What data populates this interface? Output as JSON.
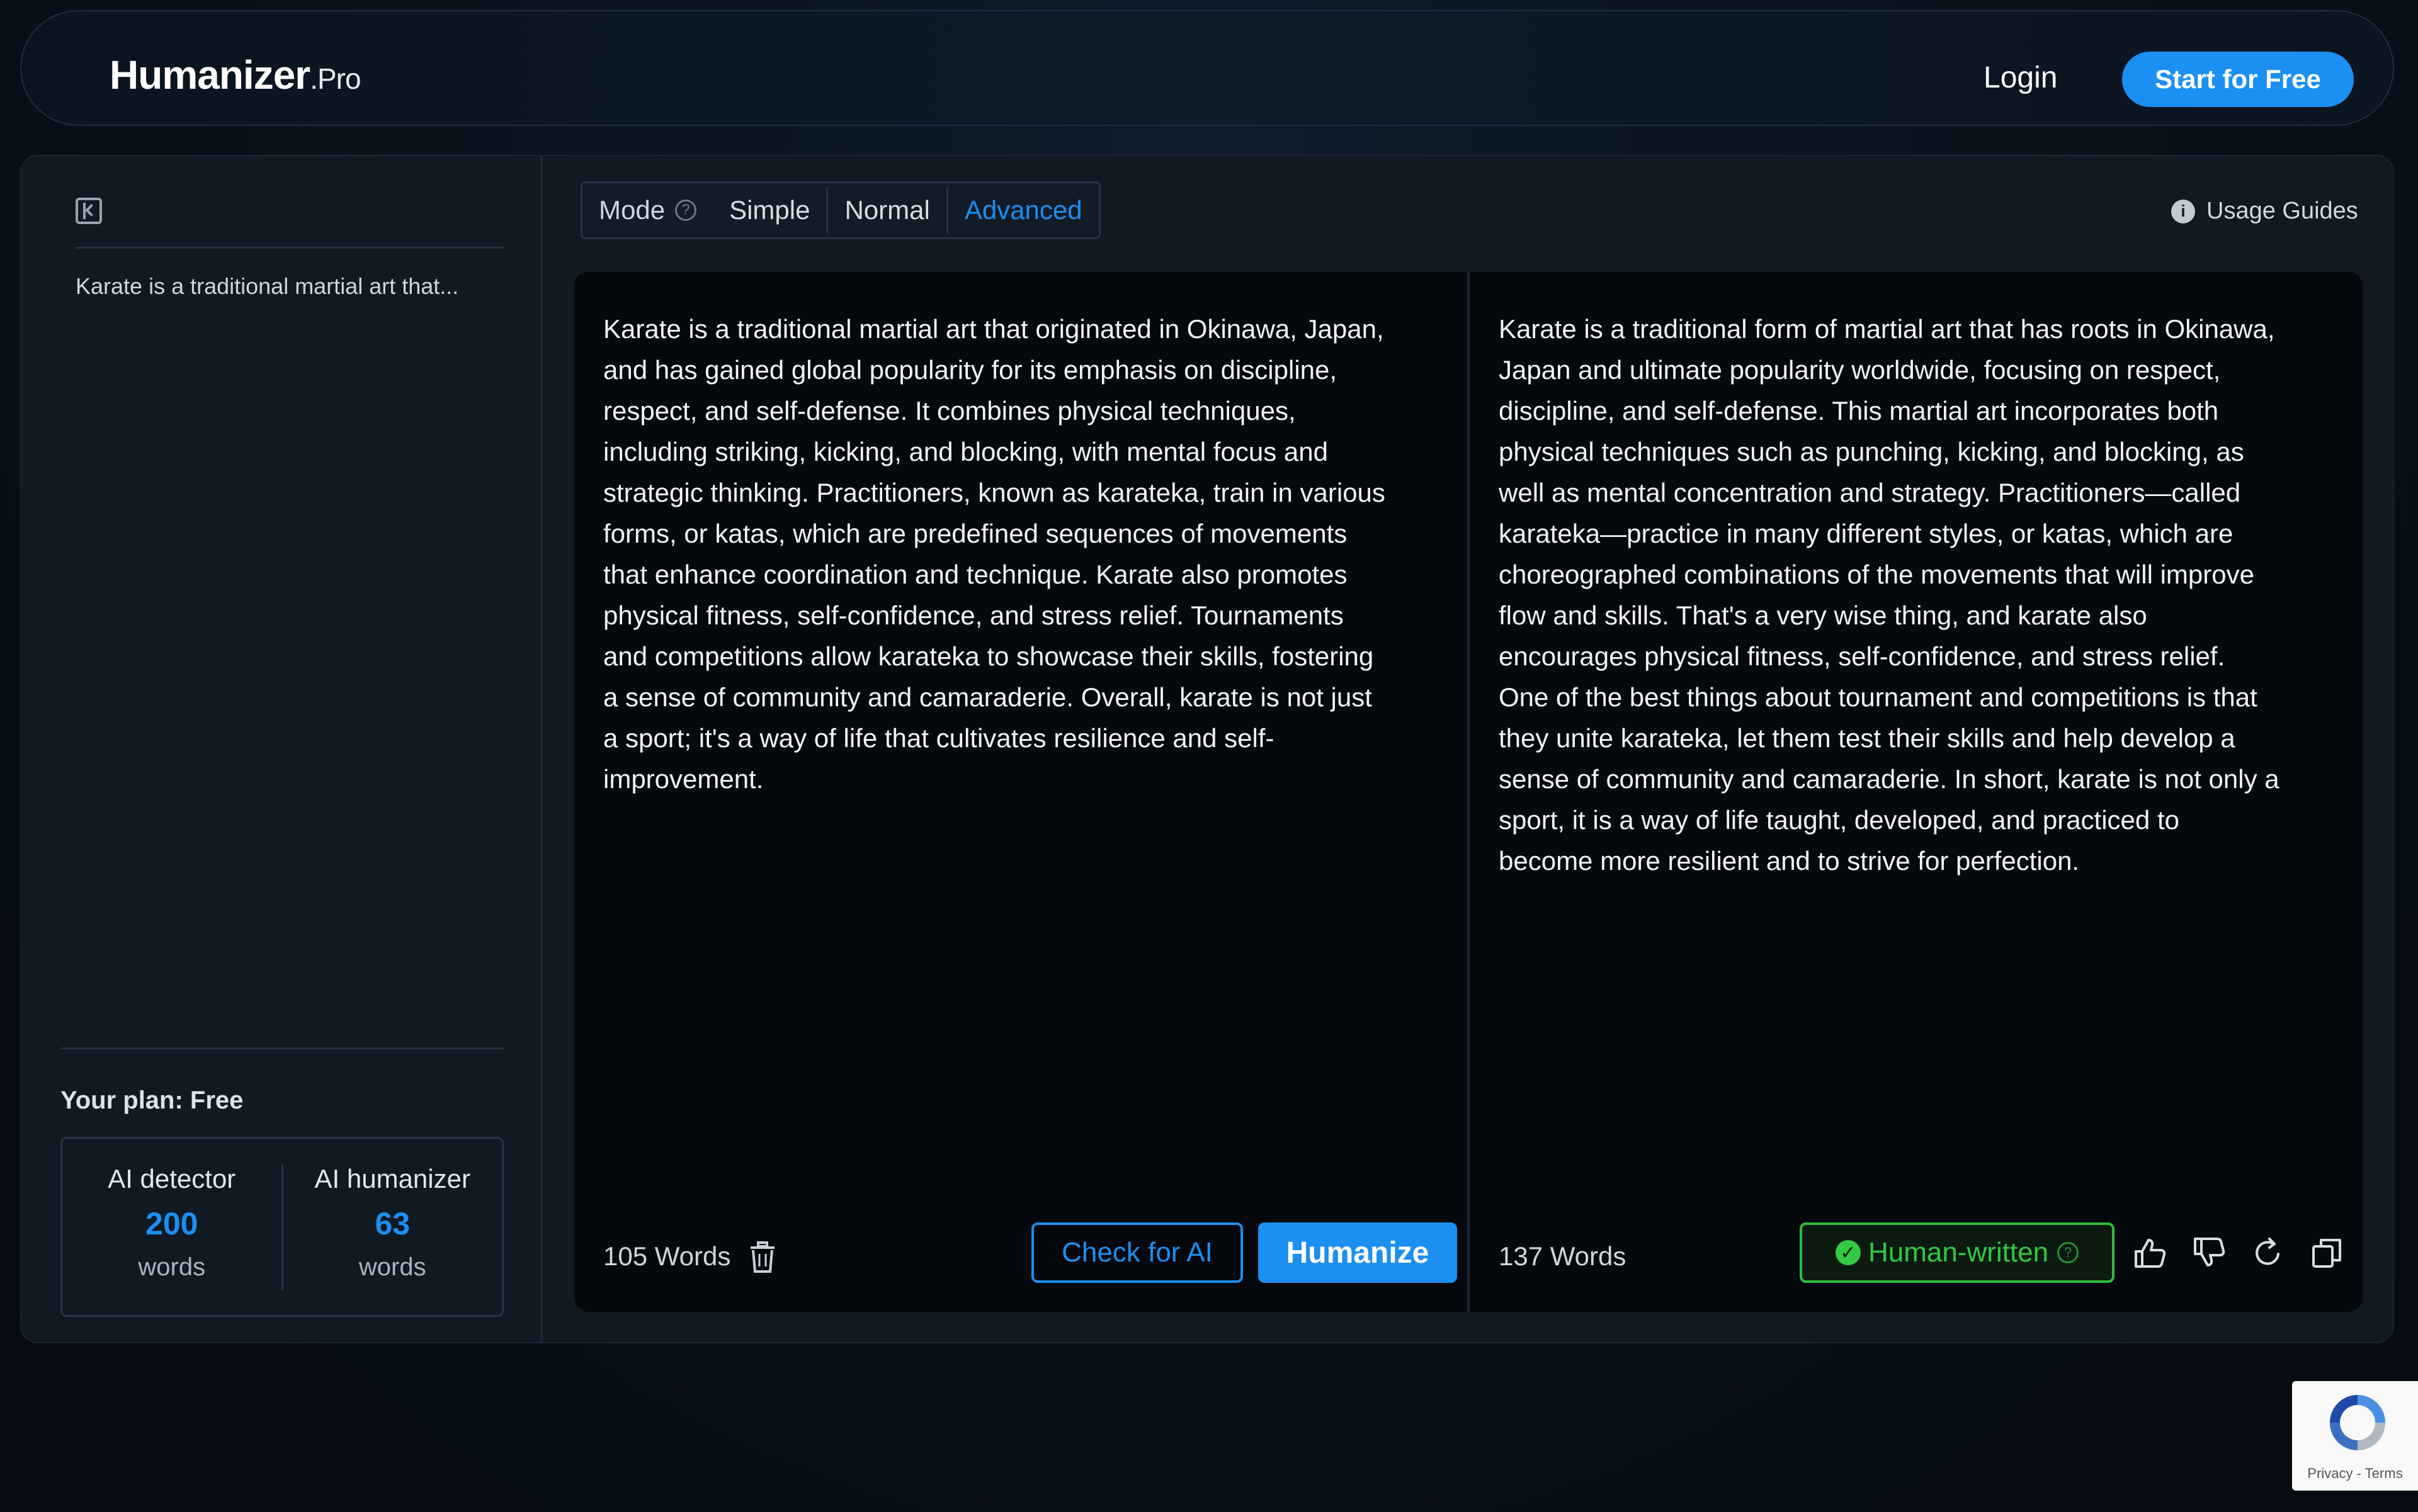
{
  "header": {
    "brand_name": "Humanizer",
    "brand_suffix": ".Pro",
    "login_label": "Login",
    "cta_label": "Start for Free",
    "accent_color": "#1b8ff2"
  },
  "sidebar": {
    "toggle_icon": "sidebar-collapse-icon",
    "history": [
      {
        "label": "Karate is a traditional martial art that..."
      }
    ],
    "plan": {
      "title": "Your plan: Free",
      "detector": {
        "label": "AI detector",
        "value": "200",
        "unit": "words"
      },
      "humanizer": {
        "label": "AI humanizer",
        "value": "63",
        "unit": "words"
      }
    }
  },
  "mode": {
    "label": "Mode",
    "help_icon": "question-icon",
    "options": [
      "Simple",
      "Normal",
      "Advanced"
    ],
    "selected": "Advanced"
  },
  "usage_guides": {
    "icon": "info-icon",
    "label": "Usage Guides"
  },
  "input": {
    "text": "Karate is a traditional martial art that originated in Okinawa, Japan,\nand has gained global popularity for its emphasis on discipline,\nrespect, and self-defense. It combines physical techniques,\nincluding striking, kicking, and blocking, with mental focus and\nstrategic thinking. Practitioners, known as karateka, train in various\nforms, or katas, which are predefined sequences of movements\nthat enhance coordination and technique. Karate also promotes\nphysical fitness, self-confidence, and stress relief. Tournaments\nand competitions allow karateka to showcase their skills, fostering\na sense of community and camaraderie. Overall, karate is not just\na sport; it's a way of life that cultivates resilience and self-\nimprovement.",
    "word_count": "105 Words",
    "check_label": "Check for AI",
    "humanize_label": "Humanize"
  },
  "output": {
    "text": "Karate is a traditional form of martial art that has roots in Okinawa,\nJapan and ultimate popularity worldwide, focusing on respect,\ndiscipline, and self-defense. This martial art incorporates both\nphysical techniques such as punching, kicking, and blocking, as\nwell as mental concentration and strategy. Practitioners—called\nkarateka—practice in many different styles, or katas, which are\nchoreographed combinations of the movements that will improve\nflow and skills. That's a very wise thing, and karate also\nencourages physical fitness, self-confidence, and stress relief.\nOne of the best things about tournament and competitions is that\nthey unite karateka, let them test their skills and help develop a\nsense of community and camaraderie. In short, karate is not only a\nsport, it is a way of life taught, developed, and practiced to\nbecome more resilient and to strive for perfection.",
    "word_count": "137 Words",
    "status_label": "Human-written",
    "status_color": "#33c842",
    "actions": [
      "thumbs-up-icon",
      "thumbs-down-icon",
      "regenerate-icon",
      "copy-icon"
    ]
  },
  "recaptcha": {
    "links": "Privacy - Terms"
  }
}
